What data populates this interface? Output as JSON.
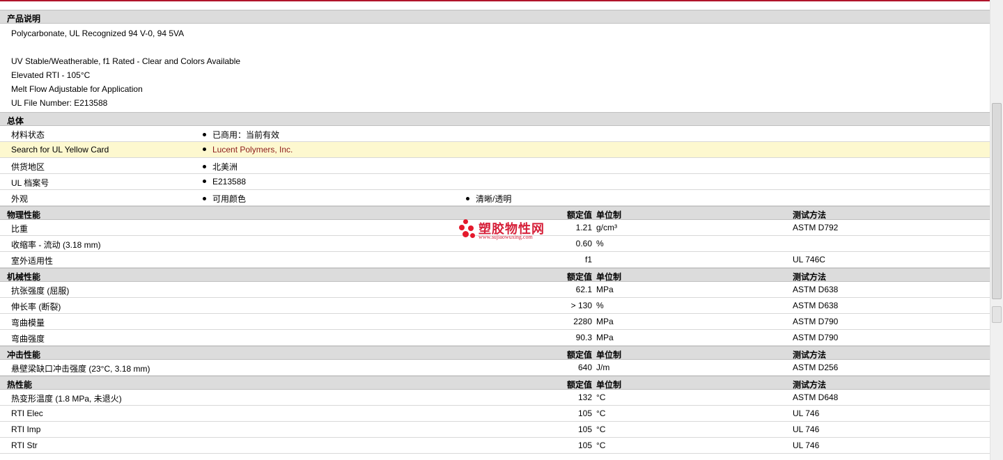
{
  "product_description": {
    "title": "产品说明",
    "lines": [
      "Polycarbonate, UL Recognized 94 V-0, 94 5VA",
      "",
      "UV Stable/Weatherable, f1 Rated - Clear and Colors Available",
      "Elevated RTI - 105°C",
      "Melt Flow Adjustable for Application",
      "UL File Number: E213588"
    ]
  },
  "general": {
    "title": "总体",
    "rows": [
      {
        "label": "材料状态",
        "values": [
          "已商用：当前有效"
        ]
      },
      {
        "label": "Search for UL Yellow Card",
        "values": [
          "Lucent Polymers, Inc."
        ]
      },
      {
        "label": "供货地区",
        "values": [
          "北美洲"
        ]
      },
      {
        "label": "UL 档案号",
        "values": [
          "E213588"
        ]
      },
      {
        "label": "外观",
        "values": [
          "可用颜色",
          "清晰/透明"
        ]
      }
    ]
  },
  "column_headers": {
    "value": "额定值",
    "unit": "单位制",
    "test": "测试方法"
  },
  "physical": {
    "title": "物理性能",
    "rows": [
      {
        "label": "比重",
        "value": "1.21",
        "unit": "g/cm³",
        "test": "ASTM D792"
      },
      {
        "label": "收缩率 - 流动 (3.18 mm)",
        "value": "0.60",
        "unit": "%",
        "test": ""
      },
      {
        "label": "室外适用性",
        "value": "f1",
        "unit": "",
        "test": "UL 746C"
      }
    ]
  },
  "mechanical": {
    "title": "机械性能",
    "rows": [
      {
        "label": "抗张强度 (屈服)",
        "value": "62.1",
        "unit": "MPa",
        "test": "ASTM D638"
      },
      {
        "label": "伸长率 (断裂)",
        "value": "> 130",
        "unit": "%",
        "test": "ASTM D638"
      },
      {
        "label": "弯曲模量",
        "value": "2280",
        "unit": "MPa",
        "test": "ASTM D790"
      },
      {
        "label": "弯曲强度",
        "value": "90.3",
        "unit": "MPa",
        "test": "ASTM D790"
      }
    ]
  },
  "impact": {
    "title": "冲击性能",
    "rows": [
      {
        "label": "悬壁梁缺口冲击强度 (23°C, 3.18 mm)",
        "value": "640",
        "unit": "J/m",
        "test": "ASTM D256"
      }
    ]
  },
  "thermal": {
    "title": "热性能",
    "rows": [
      {
        "label": "热变形温度 (1.8 MPa, 未退火)",
        "value": "132",
        "unit": "°C",
        "test": "ASTM D648"
      },
      {
        "label": "RTI Elec",
        "value": "105",
        "unit": "°C",
        "test": "UL 746"
      },
      {
        "label": "RTI Imp",
        "value": "105",
        "unit": "°C",
        "test": "UL 746"
      },
      {
        "label": "RTI Str",
        "value": "105",
        "unit": "°C",
        "test": "UL 746"
      }
    ]
  },
  "watermark": {
    "title": "塑胶物性网",
    "url": "www.sujiaowuxing.com",
    "color": "#d6213a"
  },
  "colors": {
    "accent": "#b0142a",
    "highlight": "#fdf8cf",
    "header_bg": "#dcdcdc",
    "link": "#8b1a1a"
  }
}
